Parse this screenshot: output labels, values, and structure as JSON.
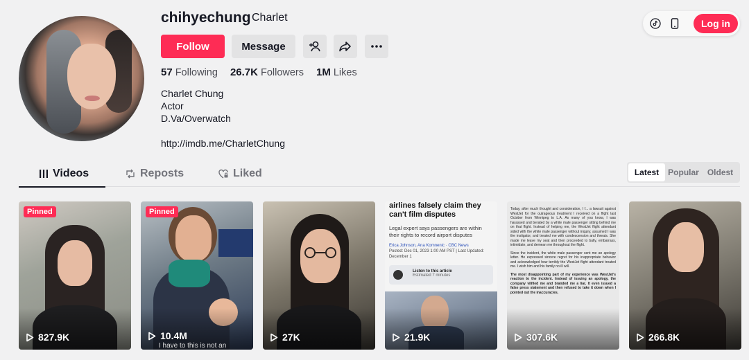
{
  "profile": {
    "username": "chihyechung",
    "nickname": "Charlet",
    "follow_label": "Follow",
    "message_label": "Message",
    "stats": [
      {
        "value": "57",
        "label": "Following"
      },
      {
        "value": "26.7K",
        "label": "Followers"
      },
      {
        "value": "1M",
        "label": "Likes"
      }
    ],
    "bio": [
      "Charlet Chung",
      "Actor",
      "D.Va/Overwatch"
    ],
    "link": "http://imdb.me/CharletChung"
  },
  "topbar": {
    "login_label": "Log in",
    "icons": [
      "tiktok-icon",
      "phone-icon"
    ]
  },
  "tabs": [
    {
      "label": "Videos",
      "icon": "grid-icon",
      "active": true
    },
    {
      "label": "Reposts",
      "icon": "repost-icon",
      "active": false
    },
    {
      "label": "Liked",
      "icon": "heart-lock-icon",
      "active": false
    }
  ],
  "sort": [
    "Latest",
    "Popular",
    "Oldest"
  ],
  "videos": [
    {
      "views": "827.9K",
      "pinned_label": "Pinned"
    },
    {
      "views": "10.4M",
      "pinned_label": "Pinned",
      "caption": "I have to this is not an"
    },
    {
      "views": "27K"
    },
    {
      "views": "21.9K",
      "headline": "airlines falsely claim they can't film disputes",
      "subhead": "Legal expert says passengers are within their rights to record airport disputes",
      "byline": "Erica Johnson, Ana Komnenic · CBC News",
      "posted": "Posted: Dec 01, 2023 1:00 AM PST | Last Updated: December 1",
      "audio_label": "Listen to this article",
      "audio_time": "Estimated 7 minutes"
    },
    {
      "views": "307.6K",
      "letter": [
        "Today, after much thought and consideration, I f... a lawsuit against WestJet for the outrageous treatment I received on a flight last October from Winnipeg to L.A. As many of you know, I was harassed and berated by a white male passenger sitting behind me on that flight. Instead of helping me, the WestJet flight attendant sided with the white male passenger without inquiry, assumed I was the instigator, and treated me with condescension and threats. She made me leave my seat and then proceeded to bully, embarrass, intimidate, and demean me throughout the flight.",
        "Since the incident, the white male passenger sent me an apology letter. He expressed sincere regret for his inappropriate behavior and acknowledged how terribly the WestJet flight attendant treated me. I wish him and his family no ill will.",
        "The most disappointing part of my experience was WestJet's reaction to the incident. Instead of issuing an apology, the company vilified me and branded me a liar. It even issued a false press statement and then refused to take it down when I pointed out the inaccuracies."
      ]
    },
    {
      "views": "266.8K"
    }
  ],
  "colors": {
    "accent": "#fe2c55",
    "background": "#f1f1f2",
    "text": "#161823"
  }
}
